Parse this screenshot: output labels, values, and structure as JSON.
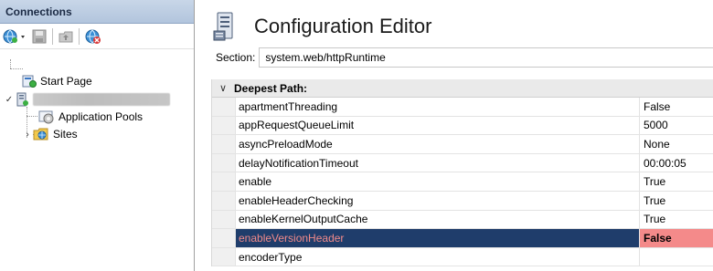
{
  "connections": {
    "title": "Connections",
    "tree": [
      {
        "label": "Start Page"
      },
      {
        "label": ""
      },
      {
        "label": "Application Pools"
      },
      {
        "label": "Sites"
      }
    ]
  },
  "editor": {
    "title": "Configuration Editor",
    "section_label": "Section:",
    "section_value": "system.web/httpRuntime",
    "group_header": "Deepest Path:",
    "rows": [
      {
        "name": "apartmentThreading",
        "value": "False"
      },
      {
        "name": "appRequestQueueLimit",
        "value": "5000"
      },
      {
        "name": "asyncPreloadMode",
        "value": "None"
      },
      {
        "name": "delayNotificationTimeout",
        "value": "00:00:05"
      },
      {
        "name": "enable",
        "value": "True"
      },
      {
        "name": "enableHeaderChecking",
        "value": "True"
      },
      {
        "name": "enableKernelOutputCache",
        "value": "True"
      },
      {
        "name": "enableVersionHeader",
        "value": "False"
      },
      {
        "name": "encoderType",
        "value": ""
      }
    ],
    "selected_row": "enableVersionHeader"
  },
  "colors": {
    "selected_name_bg": "#1f3d6b",
    "selected_value_bg": "#f48a8a"
  }
}
